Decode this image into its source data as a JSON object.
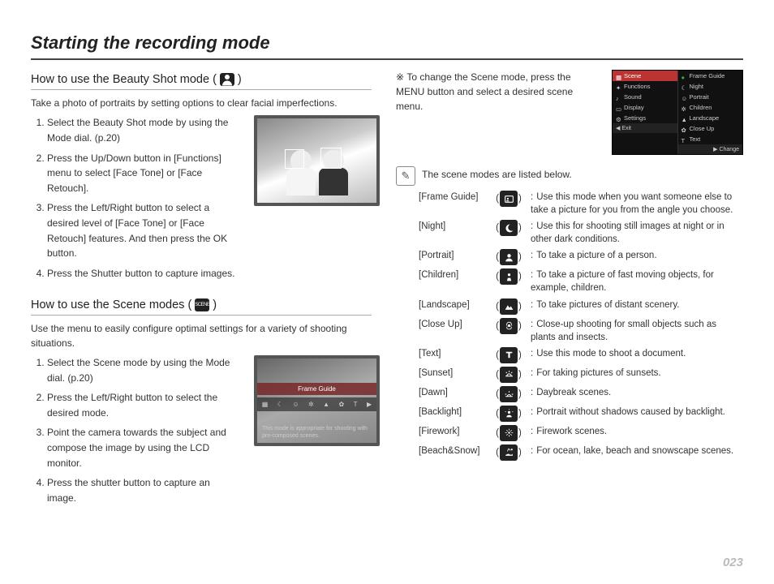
{
  "title": "Starting the recording mode",
  "page_number": "023",
  "beauty": {
    "heading_pre": "How to use the Beauty Shot mode (",
    "heading_post": ")",
    "intro": "Take a photo of portraits by setting options to clear facial imperfections.",
    "steps": [
      "Select the Beauty Shot mode by using the Mode dial. (p.20)",
      "Press the Up/Down button in [Functions] menu to select [Face Tone] or [Face Retouch].",
      "Press the Left/Right button to select a desired level of [Face Tone] or [Face Retouch] features. And then press the OK button.",
      "Press the Shutter button to capture images."
    ]
  },
  "scene": {
    "heading_pre": "How to use the Scene modes (",
    "heading_post": ")",
    "heading_icon_label": "SCENE",
    "intro": "Use the menu to easily configure optimal settings for a variety of shooting situations.",
    "steps": [
      "Select the Scene mode by using the Mode dial. (p.20)",
      "Press the Left/Right button to select the desired mode.",
      "Point the camera towards the subject and compose the image by using the LCD monitor.",
      "Press the shutter button to capture an image."
    ],
    "thumb_banner": "Frame Guide",
    "thumb_caption": "This mode is appropriate for shooting with pre-composed scenes."
  },
  "change_scene_note": "To change the Scene mode, press the MENU button and select a desired scene menu.",
  "menu_sim": {
    "left": [
      "Scene",
      "Functions",
      "Sound",
      "Display",
      "Settings"
    ],
    "right": [
      "Frame Guide",
      "Night",
      "Portrait",
      "Children",
      "Landscape",
      "Close Up",
      "Text"
    ],
    "footer_left": "Exit",
    "footer_right": "Change"
  },
  "listed_intro": "The scene modes are listed below.",
  "scene_modes": [
    {
      "label": "[Frame Guide]",
      "desc": "Use this mode when you want someone else to take a picture for you from the angle you choose."
    },
    {
      "label": "[Night]",
      "desc": "Use this for shooting still images at night or in other dark conditions."
    },
    {
      "label": "[Portrait]",
      "desc": "To take a picture of a person."
    },
    {
      "label": "[Children]",
      "desc": "To take a picture of fast moving objects, for example, children."
    },
    {
      "label": "[Landscape]",
      "desc": "To take pictures of distant scenery."
    },
    {
      "label": "[Close Up]",
      "desc": "Close-up shooting for small objects such as plants and insects."
    },
    {
      "label": "[Text]",
      "desc": "Use this mode to shoot a document."
    },
    {
      "label": "[Sunset]",
      "desc": "For taking pictures of sunsets."
    },
    {
      "label": "[Dawn]",
      "desc": "Daybreak scenes."
    },
    {
      "label": "[Backlight]",
      "desc": "Portrait without shadows caused by backlight."
    },
    {
      "label": "[Firework]",
      "desc": "Firework scenes."
    },
    {
      "label": "[Beach&Snow]",
      "desc": "For ocean, lake, beach and snowscape scenes."
    }
  ]
}
